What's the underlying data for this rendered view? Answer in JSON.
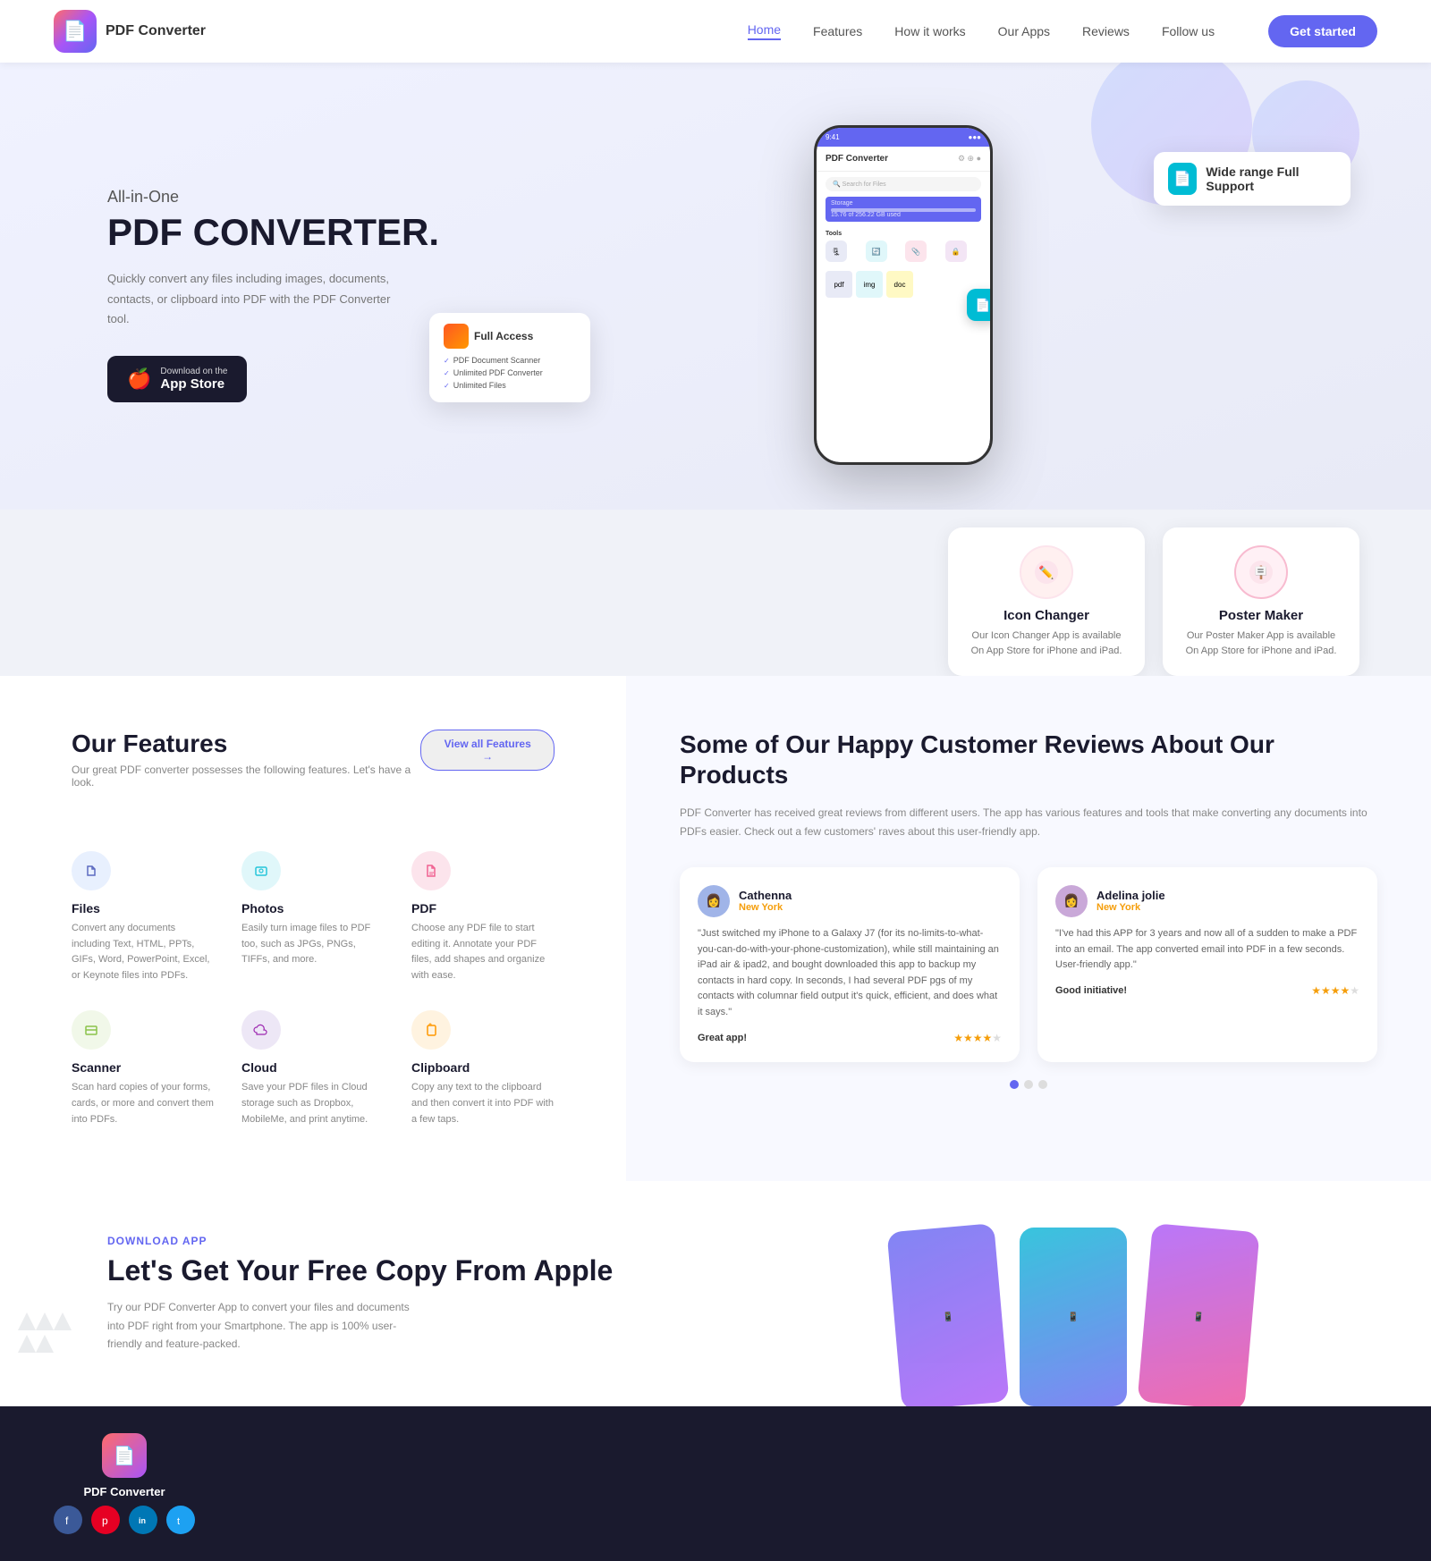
{
  "brand": {
    "name": "PDF Converter",
    "logo_emoji": "📄"
  },
  "nav": {
    "links": [
      "Home",
      "Features",
      "How it works",
      "Our Apps",
      "Reviews",
      "Follow us"
    ],
    "active_link": "Home",
    "cta_label": "Get started"
  },
  "hero": {
    "sub": "All-in-One",
    "title": "PDF CONVERTER.",
    "desc": "Quickly convert any files including images, documents, contacts, or clipboard into PDF with the PDF Converter tool.",
    "appstore_small": "Download on the",
    "appstore_big": "App Store",
    "phone_app_title": "PDF Converter",
    "floating_support_text": "Wide range Full Support",
    "floating_full_access_title": "Full Access",
    "floating_full_access_item1": "PDF Document Scanner",
    "floating_full_access_item2": "Unlimited PDF Converter",
    "floating_full_access_item3": "Unlimited Files"
  },
  "apps": [
    {
      "name": "Icon Changer",
      "desc": "Our Icon Changer App is available On App Store for iPhone and iPad.",
      "emoji": "✏️",
      "bg": "#fff0f0"
    },
    {
      "name": "Poster Maker",
      "desc": "Our Poster Maker App is available On App Store for iPhone and iPad.",
      "emoji": "🪧",
      "bg": "#fff0f5"
    }
  ],
  "features": {
    "section_title": "Our Features",
    "section_subtitle": "Our great PDF converter possesses the following features. Let's have a look.",
    "view_all_label": "View all Features →",
    "items": [
      {
        "name": "Files",
        "desc": "Convert any documents including Text, HTML, PPTs, GIFs, Word, PowerPoint, Excel, or Keynote files into PDFs.",
        "emoji": "📁",
        "bg": "#e8f0fe"
      },
      {
        "name": "Photos",
        "desc": "Easily turn image files to PDF too, such as JPGs, PNGs, TIFFs, and more.",
        "emoji": "📷",
        "bg": "#e0f7fa"
      },
      {
        "name": "PDF",
        "desc": "Choose any PDF file to start editing it. Annotate your PDF files, add shapes and organize with ease.",
        "emoji": "📄",
        "bg": "#fce4ec"
      },
      {
        "name": "Scanner",
        "desc": "Scan hard copies of your forms, cards, or more and convert them into PDFs.",
        "emoji": "🔍",
        "bg": "#f1f8e9"
      },
      {
        "name": "Cloud",
        "desc": "Save your PDF files in Cloud storage such as Dropbox, MobileMe, and print anytime.",
        "emoji": "☁️",
        "bg": "#ede7f6"
      },
      {
        "name": "Clipboard",
        "desc": "Copy any text to the clipboard and then convert it into PDF with a few taps.",
        "emoji": "📋",
        "bg": "#fff3e0"
      }
    ]
  },
  "reviews": {
    "section_title": "Some of Our Happy Customer Reviews About Our Products",
    "intro": "PDF Converter has received great reviews from different users. The app has various features and tools that make converting any documents into PDFs easier. Check out a few customers' raves about this user-friendly app.",
    "items": [
      {
        "name": "Cathenna",
        "location": "New York",
        "text": "\"Just switched my iPhone to a Galaxy J7 (for its no-limits-to-what-you-can-do-with-your-phone-customization), while still maintaining an iPad air & ipad2, and bought downloaded this app to backup my contacts in hard copy. In seconds, I had several PDF pgs of my contacts with columnar field output it's quick, efficient, and does what it says.\"",
        "label": "Great app!",
        "stars": 4,
        "avatar_emoji": "👩",
        "avatar_bg": "#a0b4e8"
      },
      {
        "name": "Adelina jolie",
        "location": "New York",
        "text": "\"I've had this APP for 3 years and now all of a sudden to make a PDF into an email. The app converted email into PDF in a few seconds. User-friendly app.\"",
        "label": "Good initiative!",
        "stars": 4,
        "avatar_emoji": "👩",
        "avatar_bg": "#c9a8d8"
      }
    ],
    "dots": [
      true,
      false,
      false
    ]
  },
  "download": {
    "label": "DOWNLOAD APP",
    "title": "Let's Get Your Free Copy From Apple",
    "desc": "Try our PDF Converter App to convert your files and documents into PDF right from your Smartphone. The app is 100% user-friendly and feature-packed."
  },
  "footer": {
    "app_name": "PDF Converter",
    "socials": [
      {
        "icon": "f",
        "bg": "#3b5998",
        "name": "facebook"
      },
      {
        "icon": "p",
        "bg": "#e60023",
        "name": "pinterest"
      },
      {
        "icon": "in",
        "bg": "#0077b5",
        "name": "linkedin"
      },
      {
        "icon": "t",
        "bg": "#1da1f2",
        "name": "twitter"
      }
    ]
  },
  "colors": {
    "primary": "#6366f1",
    "dark": "#1a1a2e",
    "orange": "#f59e0b",
    "feature_bg": [
      "#e8f0fe",
      "#e0f7fa",
      "#fce4ec",
      "#f1f8e9",
      "#ede7f6",
      "#fff3e0"
    ],
    "feature_icon": [
      "#5c6bc0",
      "#26c6da",
      "#f06292",
      "#8bc34a",
      "#9c27b0",
      "#ff9800"
    ]
  }
}
